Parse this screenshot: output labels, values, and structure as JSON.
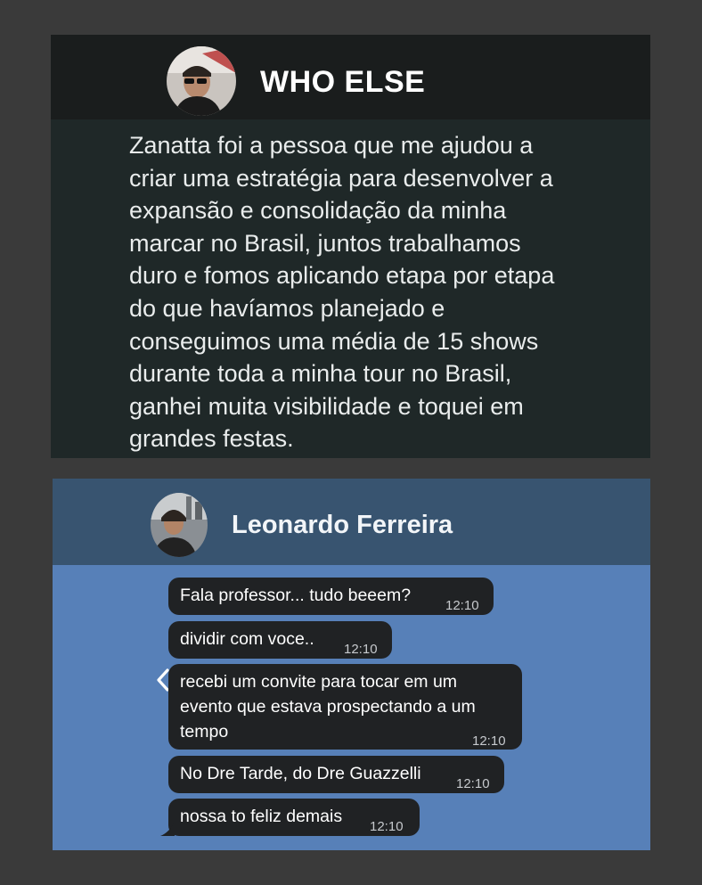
{
  "card1": {
    "contact_name": "WHO ELSE",
    "message_lines": [
      "Zanatta foi a pessoa que me ajudou a",
      "criar uma estratégia para desenvolver a",
      "expansão e consolidação da minha",
      "marcar no Brasil, juntos trabalhamos",
      "duro e fomos aplicando etapa por etapa",
      "do que havíamos planejado e",
      "conseguimos uma média de 15 shows",
      "durante toda a minha tour no Brasil,",
      "ganhei muita visibilidade e toquei em",
      "grandes festas."
    ],
    "colors": {
      "header_bg": "#1a1d1d",
      "body_bg": "#1f2828"
    }
  },
  "card2": {
    "contact_name": "Leonardo Ferreira",
    "back_icon": "chevron-left-icon",
    "messages": [
      {
        "lines": [
          "Fala professor... tudo beeem?"
        ],
        "time": "12:10"
      },
      {
        "lines": [
          "dividir com voce.."
        ],
        "time": "12:10"
      },
      {
        "lines": [
          "recebi um convite para tocar em um",
          "evento que estava prospectando a um",
          "tempo"
        ],
        "time": "12:10"
      },
      {
        "lines": [
          "No Dre Tarde, do Dre Guazzelli"
        ],
        "time": "12:10"
      },
      {
        "lines": [
          "nossa to feliz demais"
        ],
        "time": "12:10"
      }
    ],
    "colors": {
      "header_bg": "#385470",
      "chat_bg": "#5780b8",
      "bubble_bg": "#202224"
    }
  }
}
